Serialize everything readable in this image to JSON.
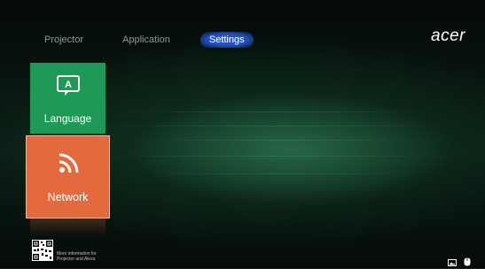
{
  "nav": {
    "tabs": [
      {
        "label": "Projector"
      },
      {
        "label": "Application"
      },
      {
        "label": "Settings",
        "active": true
      }
    ]
  },
  "brand": {
    "logo_text": "acer"
  },
  "tiles": [
    {
      "label": "Language",
      "icon": "language-icon",
      "color": "#1f9a56"
    },
    {
      "label": "Network",
      "icon": "wifi-icon",
      "color": "#e36a3c"
    }
  ],
  "footer": {
    "qr_text_line1": "More information for",
    "qr_text_line2": "Projector and Alexa",
    "icons": [
      "picture-icon",
      "mouse-icon"
    ]
  }
}
